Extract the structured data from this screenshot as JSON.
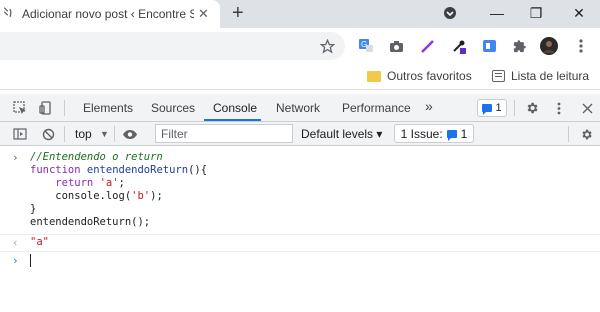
{
  "tab": {
    "title": "Adicionar novo post ‹ Encontre Sol…",
    "favicon": "eye-glyph",
    "close_glyph": "✕"
  },
  "window": {
    "new_tab_glyph": "+",
    "minimize_glyph": "—",
    "restore_glyph": "❐",
    "close_glyph": "✕"
  },
  "bookmarks": {
    "items": [
      {
        "label": "Outros favoritos",
        "icon": "folder-icon"
      },
      {
        "label": "Lista de leitura",
        "icon": "reading-list-icon"
      }
    ]
  },
  "devtools": {
    "tabs": [
      {
        "label": "Elements"
      },
      {
        "label": "Sources"
      },
      {
        "label": "Console"
      },
      {
        "label": "Network"
      },
      {
        "label": "Performance"
      }
    ],
    "more_tabs_glyph": "»",
    "issues_count": "1",
    "active_tab": "Console"
  },
  "console_toolbar": {
    "context": "top",
    "filter_placeholder": "Filter",
    "levels": "Default levels ▾",
    "issue_label": "1 Issue:",
    "issue_count": "1"
  },
  "console": {
    "input_lines": [
      {
        "segments": [
          {
            "t": "//Entendendo o return",
            "c": "cm"
          }
        ]
      },
      {
        "segments": [
          {
            "t": "function ",
            "c": "kw"
          },
          {
            "t": "entendendoReturn",
            "c": "fn"
          },
          {
            "t": "(){",
            "c": "plain"
          }
        ]
      },
      {
        "segments": [
          {
            "t": "    ",
            "c": "plain"
          },
          {
            "t": "return ",
            "c": "kw"
          },
          {
            "t": "'a'",
            "c": "str"
          },
          {
            "t": ";",
            "c": "plain"
          }
        ]
      },
      {
        "segments": [
          {
            "t": "    console.log(",
            "c": "plain"
          },
          {
            "t": "'b'",
            "c": "str"
          },
          {
            "t": ");",
            "c": "plain"
          }
        ]
      },
      {
        "segments": [
          {
            "t": "}",
            "c": "plain"
          }
        ]
      },
      {
        "segments": [
          {
            "t": "entendendoReturn();",
            "c": "plain"
          }
        ]
      }
    ],
    "result": "\"a\"",
    "prompt_arrow": "›",
    "result_arrow": "‹"
  },
  "colors": {
    "accent": "#1a73e8",
    "keyword": "#8a2bb6",
    "string": "#c41a16",
    "comment": "#1d6f1d"
  }
}
